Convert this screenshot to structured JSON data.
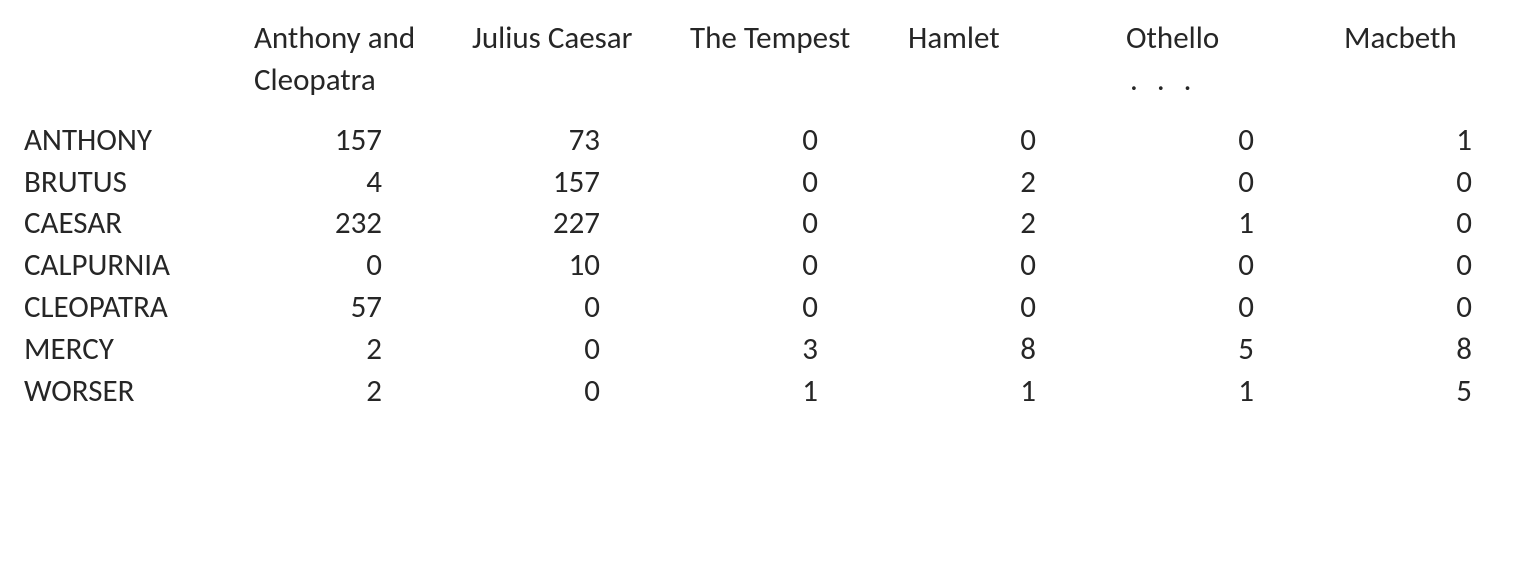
{
  "table": {
    "columns": [
      "Anthony and Cleopatra",
      "Julius Caesar",
      "The Tempest",
      "Hamlet",
      "Othello",
      "Macbeth"
    ],
    "ellipsis": ". . .",
    "rows": [
      {
        "label": "ANTHONY",
        "values": [
          157,
          73,
          0,
          0,
          0,
          1
        ]
      },
      {
        "label": "BRUTUS",
        "values": [
          4,
          157,
          0,
          2,
          0,
          0
        ]
      },
      {
        "label": "CAESAR",
        "values": [
          232,
          227,
          0,
          2,
          1,
          0
        ]
      },
      {
        "label": "CALPURNIA",
        "values": [
          0,
          10,
          0,
          0,
          0,
          0
        ]
      },
      {
        "label": "CLEOPATRA",
        "values": [
          57,
          0,
          0,
          0,
          0,
          0
        ]
      },
      {
        "label": "MERCY",
        "values": [
          2,
          0,
          3,
          8,
          5,
          8
        ]
      },
      {
        "label": "WORSER",
        "values": [
          2,
          0,
          1,
          1,
          1,
          5
        ]
      }
    ]
  }
}
